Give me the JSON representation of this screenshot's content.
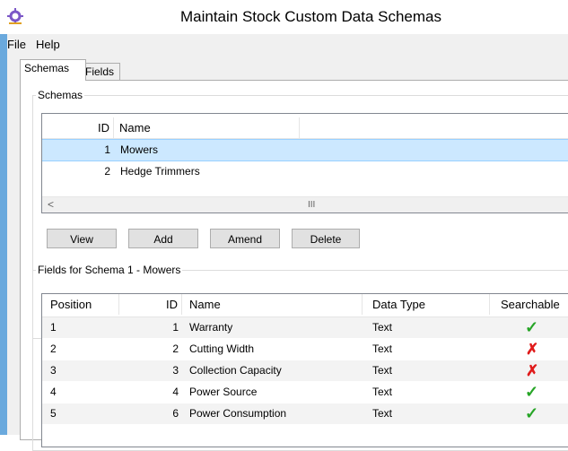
{
  "window": {
    "title": "Maintain Stock Custom Data Schemas"
  },
  "menu": {
    "items": [
      "File",
      "Help"
    ]
  },
  "tabs": [
    "Schemas",
    "Fields"
  ],
  "schemas_group": {
    "title": "Schemas",
    "columns": [
      "ID",
      "Name"
    ],
    "rows": [
      {
        "id": "1",
        "name": "Mowers"
      },
      {
        "id": "2",
        "name": "Hedge Trimmers"
      }
    ],
    "scroll_left": "<",
    "scroll_thumb": "III"
  },
  "buttons": {
    "view": "View",
    "add": "Add",
    "amend": "Amend",
    "delete": "Delete"
  },
  "fields_group": {
    "title": "Fields for Schema 1 - Mowers",
    "columns": [
      "Position",
      "ID",
      "Name",
      "Data Type",
      "Searchable"
    ],
    "rows": [
      {
        "position": "1",
        "id": "1",
        "name": "Warranty",
        "data_type": "Text",
        "searchable": "✓"
      },
      {
        "position": "2",
        "id": "2",
        "name": "Cutting Width",
        "data_type": "Text",
        "searchable": "✗"
      },
      {
        "position": "3",
        "id": "3",
        "name": "Collection Capacity",
        "data_type": "Text",
        "searchable": "✗"
      },
      {
        "position": "4",
        "id": "4",
        "name": "Power Source",
        "data_type": "Text",
        "searchable": "✓"
      },
      {
        "position": "5",
        "id": "6",
        "name": "Power Consumption",
        "data_type": "Text",
        "searchable": "✓"
      }
    ]
  },
  "colors": {
    "selection": "#cce8ff",
    "tick": "#26a526",
    "cross": "#e01b1b",
    "window_edge": "#6aa9dd"
  }
}
